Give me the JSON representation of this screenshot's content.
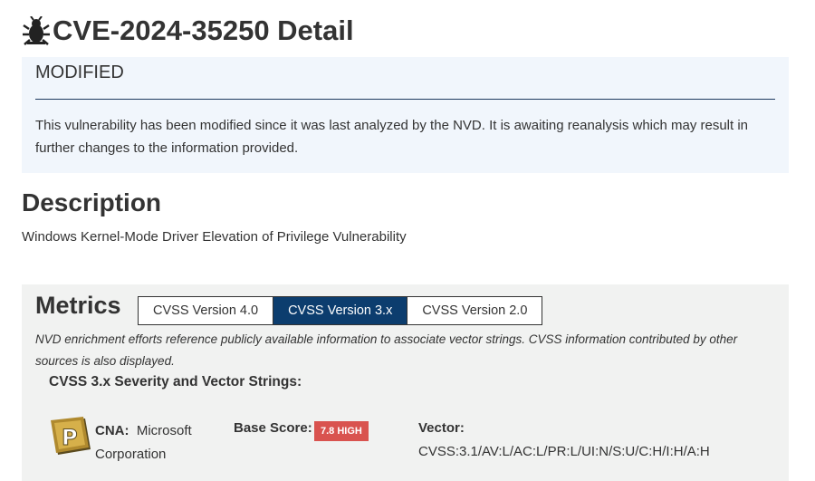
{
  "header": {
    "title": "CVE-2024-35250 Detail",
    "icon": "bug-icon"
  },
  "status_banner": {
    "heading": "MODIFIED",
    "text": "This vulnerability has been modified since it was last analyzed by the NVD. It is awaiting reanalysis which may result in further changes to the information provided.",
    "background": "#f1f6fc"
  },
  "description": {
    "heading": "Description",
    "text": "Windows Kernel-Mode Driver Elevation of Privilege Vulnerability"
  },
  "metrics": {
    "heading": "Metrics",
    "tabs": [
      {
        "label": "CVSS Version 4.0",
        "active": false
      },
      {
        "label": "CVSS Version 3.x",
        "active": true
      },
      {
        "label": "CVSS Version 2.0",
        "active": false
      }
    ],
    "enrichment_note": "NVD enrichment efforts reference publicly available information to associate vector strings. CVSS information contributed by other sources is also displayed.",
    "severity_heading": "CVSS 3.x Severity and Vector Strings:",
    "cna": {
      "label": "CNA:",
      "name": "Microsoft Corporation",
      "logo": "cna-badge-icon"
    },
    "base_score": {
      "label": "Base Score:",
      "value": "7.8 HIGH",
      "color": "#d9534f"
    },
    "vector": {
      "label": "Vector:",
      "value": "CVSS:3.1/AV:L/AC:L/PR:L/UI:N/S:U/C:H/I:H/A:H"
    }
  },
  "colors": {
    "active_tab": "#0c3d6e",
    "panel_background": "#f1f2f1",
    "text": "#333333"
  }
}
